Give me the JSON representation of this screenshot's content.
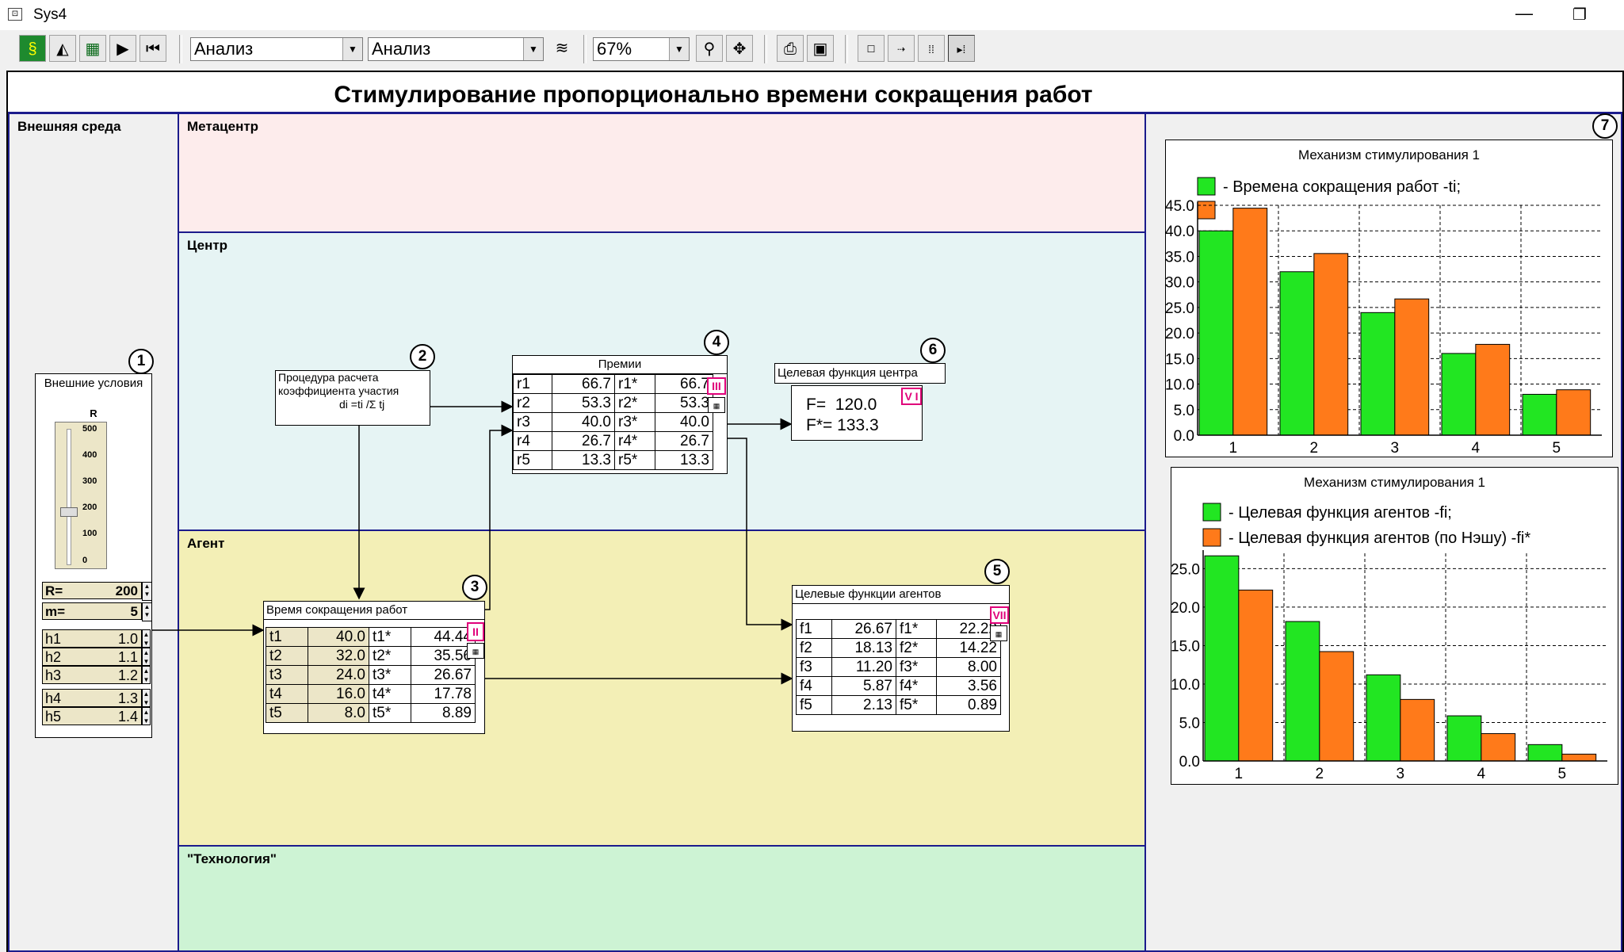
{
  "window": {
    "title": "Sys4",
    "minimize": "—",
    "restore": "❐"
  },
  "toolbar": {
    "combo1": "Анализ",
    "combo2": "Анализ",
    "zoom": "67%"
  },
  "diagram": {
    "title": "Стимулирование пропорционально времени сокращения работ",
    "lanes": {
      "env": "Внешняя среда",
      "meta": "Метацентр",
      "center": "Центр",
      "agent": "Агент",
      "tech": "\"Технология\""
    },
    "block1": {
      "num": "1",
      "title": "Внешние условия",
      "slider_label": "R",
      "ticks": [
        "500",
        "400",
        "300",
        "200",
        "100",
        "0"
      ],
      "R_label": "R=",
      "R_value": "200",
      "m_label": "m=",
      "m_value": "5",
      "h": [
        {
          "n": "h1",
          "v": "1.0"
        },
        {
          "n": "h2",
          "v": "1.1"
        },
        {
          "n": "h3",
          "v": "1.2"
        },
        {
          "n": "h4",
          "v": "1.3"
        },
        {
          "n": "h5",
          "v": "1.4"
        }
      ]
    },
    "block2": {
      "num": "2",
      "line1": "Процедура расчета",
      "line2": "коэффициента участия",
      "line3": "di =ti /Σ tj"
    },
    "block3": {
      "num": "3",
      "title": "Время сокращения работ",
      "roman": "II",
      "rows": [
        {
          "n": "t1",
          "v": "40.0",
          "sn": "t1*",
          "sv": "44.44"
        },
        {
          "n": "t2",
          "v": "32.0",
          "sn": "t2*",
          "sv": "35.56"
        },
        {
          "n": "t3",
          "v": "24.0",
          "sn": "t3*",
          "sv": "26.67"
        },
        {
          "n": "t4",
          "v": "16.0",
          "sn": "t4*",
          "sv": "17.78"
        },
        {
          "n": "t5",
          "v": "8.0",
          "sn": "t5*",
          "sv": "8.89"
        }
      ]
    },
    "block4": {
      "num": "4",
      "title": "Премии",
      "roman": "III",
      "rows": [
        {
          "n": "r1",
          "v": "66.7",
          "sn": "r1*",
          "sv": "66.7"
        },
        {
          "n": "r2",
          "v": "53.3",
          "sn": "r2*",
          "sv": "53.3"
        },
        {
          "n": "r3",
          "v": "40.0",
          "sn": "r3*",
          "sv": "40.0"
        },
        {
          "n": "r4",
          "v": "26.7",
          "sn": "r4*",
          "sv": "26.7"
        },
        {
          "n": "r5",
          "v": "13.3",
          "sn": "r5*",
          "sv": "13.3"
        }
      ]
    },
    "block5": {
      "num": "5",
      "title": "Целевые функции агентов",
      "roman": "VII",
      "rows": [
        {
          "n": "f1",
          "v": "26.67",
          "sn": "f1*",
          "sv": "22.22"
        },
        {
          "n": "f2",
          "v": "18.13",
          "sn": "f2*",
          "sv": "14.22"
        },
        {
          "n": "f3",
          "v": "11.20",
          "sn": "f3*",
          "sv": "8.00"
        },
        {
          "n": "f4",
          "v": "5.87",
          "sn": "f4*",
          "sv": "3.56"
        },
        {
          "n": "f5",
          "v": "2.13",
          "sn": "f5*",
          "sv": "0.89"
        }
      ]
    },
    "block6": {
      "num": "6",
      "title": "Целевая функция центра",
      "roman": "V I",
      "F": "F=  120.0",
      "Fs": "F*= 133.3"
    },
    "block7": {
      "num": "7"
    }
  },
  "colors": {
    "green": "#22e622",
    "orange": "#ff7a1a",
    "meta_bg": "#fdecec",
    "center_bg": "#e6f4f4",
    "agent_bg": "#f3efb6",
    "tech_bg": "#cdf3d4",
    "lane_border": "#1b1b8c"
  },
  "chart_data": [
    {
      "type": "bar",
      "title": "Механизм стимулирования 1",
      "categories": [
        "1",
        "2",
        "3",
        "4",
        "5"
      ],
      "series": [
        {
          "name": "- Времена сокращения работ -ti;",
          "color": "#22e622",
          "values": [
            40,
            32,
            24,
            16,
            8
          ]
        },
        {
          "values": [
            44.44,
            35.56,
            26.67,
            17.78,
            8.89
          ],
          "color": "#ff7a1a"
        }
      ],
      "ylim": [
        0,
        45
      ],
      "yticks": [
        "0.0",
        "5.0",
        "10.0",
        "15.0",
        "20.0",
        "25.0",
        "30.0",
        "35.0",
        "40.0",
        "45.0"
      ],
      "grid": true,
      "legend": "top"
    },
    {
      "type": "bar",
      "title": "Механизм стимулирования 1",
      "categories": [
        "1",
        "2",
        "3",
        "4",
        "5"
      ],
      "series": [
        {
          "name": "- Целевая функция агентов -fi;",
          "color": "#22e622",
          "values": [
            26.67,
            18.13,
            11.2,
            5.87,
            2.13
          ]
        },
        {
          "name": "- Целевая функция агентов (по Нэшу) -fi*",
          "color": "#ff7a1a",
          "values": [
            22.22,
            14.22,
            8.0,
            3.56,
            0.89
          ]
        }
      ],
      "ylim": [
        0,
        27
      ],
      "yticks": [
        "0.0",
        "5.0",
        "10.0",
        "15.0",
        "20.0",
        "25.0"
      ],
      "grid": true,
      "legend": "top"
    }
  ]
}
